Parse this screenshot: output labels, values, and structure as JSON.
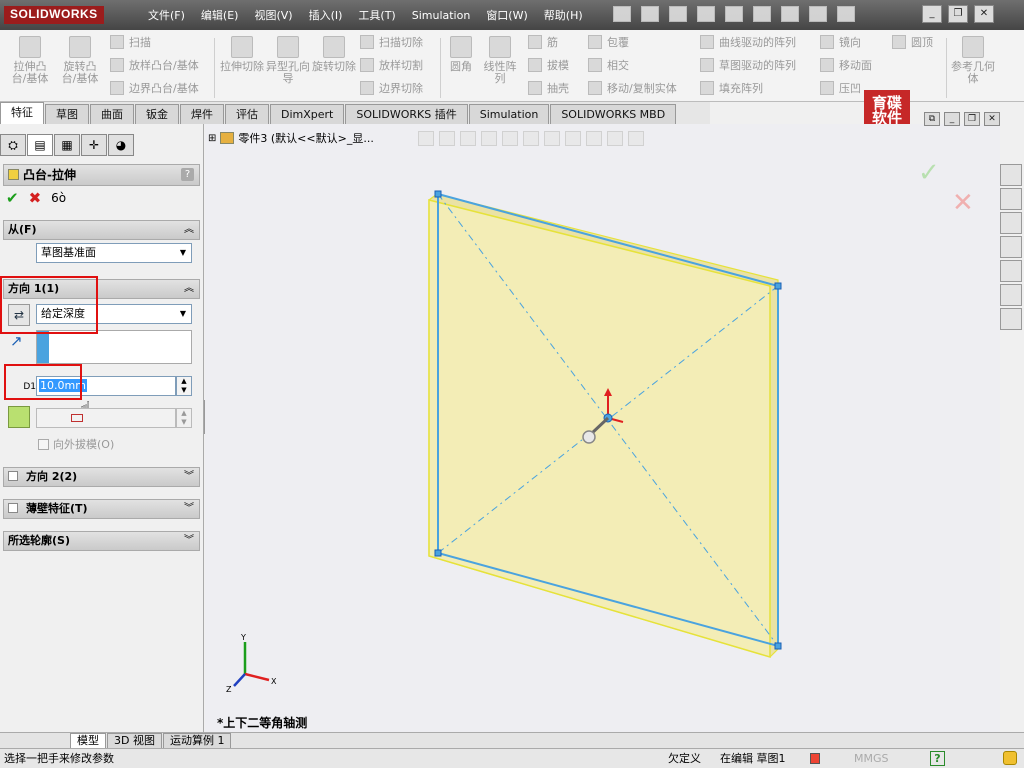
{
  "app": {
    "logo": "SOLIDWORKS"
  },
  "menu": [
    "文件(F)",
    "编辑(E)",
    "视图(V)",
    "插入(I)",
    "工具(T)",
    "Simulation",
    "窗口(W)",
    "帮助(H)"
  ],
  "ribbon": {
    "big": [
      {
        "id": "extrude-boss",
        "label": "拉伸凸台/基体"
      },
      {
        "id": "revolve-boss",
        "label": "旋转凸台/基体"
      },
      {
        "id": "extrude-cut",
        "label": "拉伸切除"
      },
      {
        "id": "hole-wizard",
        "label": "异型孔向导"
      },
      {
        "id": "revolve-cut",
        "label": "旋转切除"
      },
      {
        "id": "fillet",
        "label": "圆角"
      },
      {
        "id": "linear-pattern",
        "label": "线性阵列"
      },
      {
        "id": "ref-geometry",
        "label": "参考几何体"
      }
    ],
    "small": [
      {
        "id": "sweep",
        "label": "扫描"
      },
      {
        "id": "loft-boss",
        "label": "放样凸台/基体"
      },
      {
        "id": "boundary-boss",
        "label": "边界凸台/基体"
      },
      {
        "id": "sweep-cut",
        "label": "扫描切除"
      },
      {
        "id": "loft-cut",
        "label": "放样切割"
      },
      {
        "id": "boundary-cut",
        "label": "边界切除"
      },
      {
        "id": "rib",
        "label": "筋"
      },
      {
        "id": "draft",
        "label": "拔模"
      },
      {
        "id": "shell",
        "label": "抽壳"
      },
      {
        "id": "wrap",
        "label": "包覆"
      },
      {
        "id": "intersect",
        "label": "相交"
      },
      {
        "id": "move-copy",
        "label": "移动/复制实体"
      },
      {
        "id": "curve-pattern",
        "label": "曲线驱动的阵列"
      },
      {
        "id": "sketch-pattern",
        "label": "草图驱动的阵列"
      },
      {
        "id": "fill-pattern",
        "label": "填充阵列"
      },
      {
        "id": "mirror",
        "label": "镜向"
      },
      {
        "id": "move-face",
        "label": "移动面"
      },
      {
        "id": "indent",
        "label": "压凹"
      },
      {
        "id": "dome",
        "label": "圆顶"
      }
    ]
  },
  "tabs": [
    "特征",
    "草图",
    "曲面",
    "钣金",
    "焊件",
    "评估",
    "DimXpert",
    "SOLIDWORKS 插件",
    "Simulation",
    "SOLIDWORKS MBD"
  ],
  "watermark": {
    "line1": "育碟",
    "line2": "软件"
  },
  "panel": {
    "title": "凸台-拉伸",
    "help": "?",
    "from": {
      "header": "从(F)",
      "value": "草图基准面"
    },
    "dir1": {
      "header": "方向 1(1)",
      "end_condition": "给定深度",
      "depth": "10.0mm",
      "dim_label": "D1",
      "draft_label": "向外拔模(O)"
    },
    "dir2": {
      "header": "方向 2(2)"
    },
    "thin": {
      "header": "薄壁特征(T)"
    },
    "contours": {
      "header": "所选轮廓(S)"
    }
  },
  "viewport": {
    "tree_label": "零件3  (默认<<默认>_显...",
    "view_label": "*上下二等角轴测",
    "axes": {
      "x": "X",
      "y": "Y",
      "z": "Z"
    }
  },
  "bottom_tabs": [
    "模型",
    "3D 视图",
    "运动算例 1"
  ],
  "status": {
    "hint": "选择一把手来修改参数",
    "state": "欠定义",
    "editing": "在编辑 草图1",
    "units": "MMGS",
    "help": "?"
  },
  "colors": {
    "accent": "#4aa3df",
    "face": "#f3edb6",
    "red_box": "#e01010",
    "ok": "#1b9e1b",
    "cancel": "#d42020"
  }
}
